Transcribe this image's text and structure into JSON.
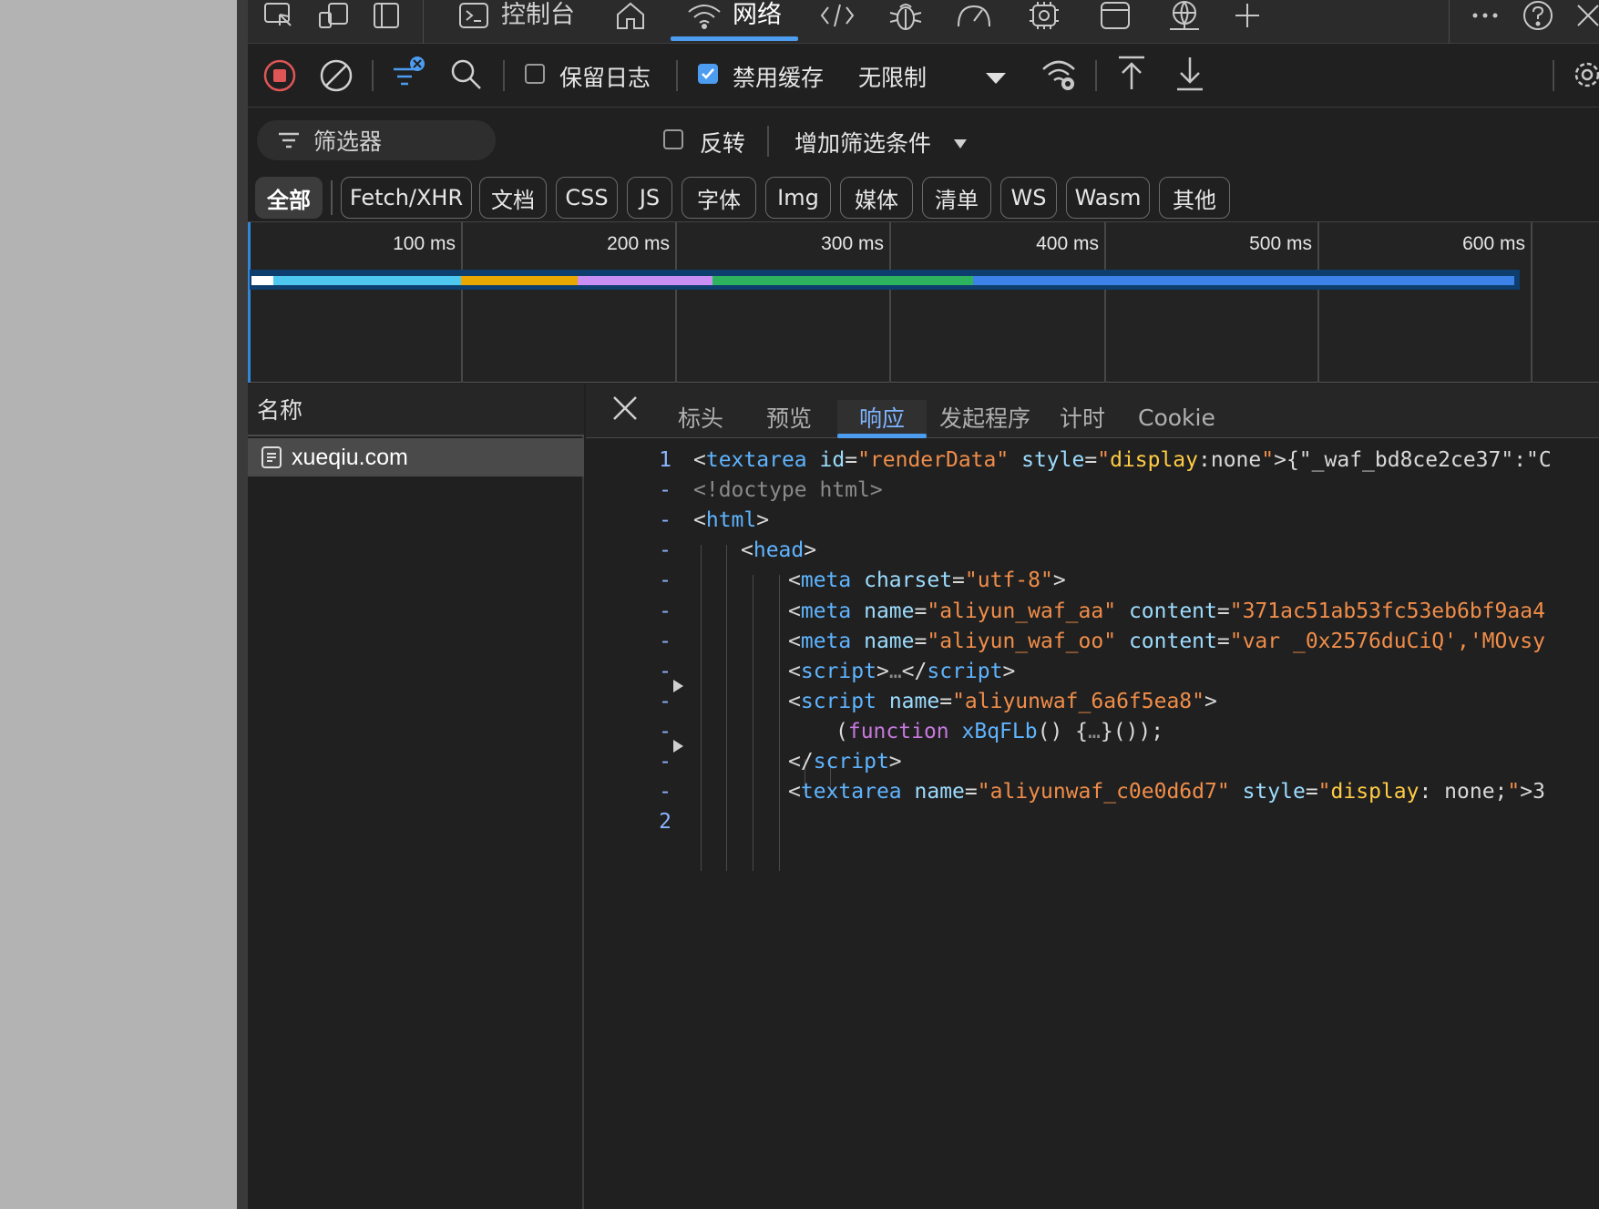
{
  "tabbar": {
    "console_label": "控制台",
    "network_label": "网络"
  },
  "toolbar": {
    "preserve_log_label": "保留日志",
    "disable_cache_label": "禁用缓存",
    "throttling_label": "无限制",
    "preserve_log_checked": false,
    "disable_cache_checked": true
  },
  "filter": {
    "placeholder": "筛选器",
    "invert_label": "反转",
    "more_filters_label": "增加筛选条件"
  },
  "type_filters": [
    "全部",
    "Fetch/XHR",
    "文档",
    "CSS",
    "JS",
    "字体",
    "Img",
    "媒体",
    "清单",
    "WS",
    "Wasm",
    "其他"
  ],
  "overview": {
    "ticks": [
      "100 ms",
      "200 ms",
      "300 ms",
      "400 ms",
      "500 ms",
      "600 ms"
    ],
    "segment_colors": [
      "#ffffff",
      "#4fc8f0",
      "#e9a800",
      "#c98ff5",
      "#2db35d",
      "#3c82e8"
    ]
  },
  "requests": {
    "column_header": "名称",
    "items": [
      "xueqiu.com"
    ]
  },
  "detail_tabs": [
    "标头",
    "预览",
    "响应",
    "发起程序",
    "计时",
    "Cookie"
  ],
  "response_lines": [
    {
      "num": "1",
      "parts": [
        [
          "p",
          "<"
        ],
        [
          "tag",
          "textarea"
        ],
        [
          "p",
          " "
        ],
        [
          "attr",
          "id"
        ],
        [
          "p",
          "="
        ],
        [
          "val",
          "\"renderData\""
        ],
        [
          "p",
          " "
        ],
        [
          "attr",
          "style"
        ],
        [
          "p",
          "="
        ],
        [
          "val",
          "\""
        ],
        [
          "y",
          "display"
        ],
        [
          "p",
          ":none"
        ],
        [
          "val",
          "\""
        ],
        [
          "p",
          ">{\"_waf_bd8ce2ce37\":\"C"
        ]
      ]
    },
    {
      "num": "-",
      "parts": [
        [
          "gray",
          "<!doctype html>"
        ]
      ]
    },
    {
      "num": "-",
      "parts": [
        [
          "p",
          "<"
        ],
        [
          "tag",
          "html"
        ],
        [
          "p",
          ">"
        ]
      ]
    },
    {
      "num": "-",
      "parts": [
        [
          "p",
          "<"
        ],
        [
          "tag",
          "head"
        ],
        [
          "p",
          ">"
        ]
      ]
    },
    {
      "num": "-",
      "parts": [
        [
          "p",
          "<"
        ],
        [
          "tag",
          "meta"
        ],
        [
          "p",
          " "
        ],
        [
          "attr",
          "charset"
        ],
        [
          "p",
          "="
        ],
        [
          "val",
          "\"utf-8\""
        ],
        [
          "p",
          ">"
        ]
      ]
    },
    {
      "num": "-",
      "parts": [
        [
          "p",
          "<"
        ],
        [
          "tag",
          "meta"
        ],
        [
          "p",
          " "
        ],
        [
          "attr",
          "name"
        ],
        [
          "p",
          "="
        ],
        [
          "val",
          "\"aliyun_waf_aa\""
        ],
        [
          "p",
          " "
        ],
        [
          "attr",
          "content"
        ],
        [
          "p",
          "="
        ],
        [
          "val",
          "\"371ac51ab53fc53eb6bf9aa4"
        ]
      ]
    },
    {
      "num": "-",
      "parts": [
        [
          "p",
          "<"
        ],
        [
          "tag",
          "meta"
        ],
        [
          "p",
          " "
        ],
        [
          "attr",
          "name"
        ],
        [
          "p",
          "="
        ],
        [
          "val",
          "\"aliyun_waf_oo\""
        ],
        [
          "p",
          " "
        ],
        [
          "attr",
          "content"
        ],
        [
          "p",
          "="
        ],
        [
          "val",
          "\"var _0x2576duCiQ','MOvsy"
        ]
      ]
    },
    {
      "num": "-",
      "parts": [
        [
          "p",
          "<"
        ],
        [
          "tag",
          "script"
        ],
        [
          "p",
          ">"
        ],
        [
          "gray",
          "…"
        ],
        [
          "p",
          "</"
        ],
        [
          "tag",
          "script"
        ],
        [
          "p",
          ">"
        ]
      ]
    },
    {
      "num": "-",
      "parts": [
        [
          "p",
          "<"
        ],
        [
          "tag",
          "script"
        ],
        [
          "p",
          " "
        ],
        [
          "attr",
          "name"
        ],
        [
          "p",
          "="
        ],
        [
          "val",
          "\"aliyunwaf_6a6f5ea8\""
        ],
        [
          "p",
          ">"
        ]
      ]
    },
    {
      "num": "-",
      "parts": [
        [
          "p",
          "("
        ],
        [
          "kw",
          "function"
        ],
        [
          "p",
          " "
        ],
        [
          "fn",
          "xBqFLb"
        ],
        [
          "p",
          "() {"
        ],
        [
          "gray",
          "…"
        ],
        [
          "p",
          "}());"
        ]
      ]
    },
    {
      "num": "-",
      "parts": [
        [
          "p",
          "</"
        ],
        [
          "tag",
          "script"
        ],
        [
          "p",
          ">"
        ]
      ]
    },
    {
      "num": "-",
      "parts": [
        [
          "p",
          "<"
        ],
        [
          "tag",
          "textarea"
        ],
        [
          "p",
          " "
        ],
        [
          "attr",
          "name"
        ],
        [
          "p",
          "="
        ],
        [
          "val",
          "\"aliyunwaf_c0e0d6d7\""
        ],
        [
          "p",
          " "
        ],
        [
          "attr",
          "style"
        ],
        [
          "p",
          "="
        ],
        [
          "val",
          "\""
        ],
        [
          "y",
          "display"
        ],
        [
          "p",
          ": none;"
        ],
        [
          "val",
          "\""
        ],
        [
          "p",
          ">3"
        ]
      ]
    },
    {
      "num": "2",
      "parts": []
    }
  ]
}
